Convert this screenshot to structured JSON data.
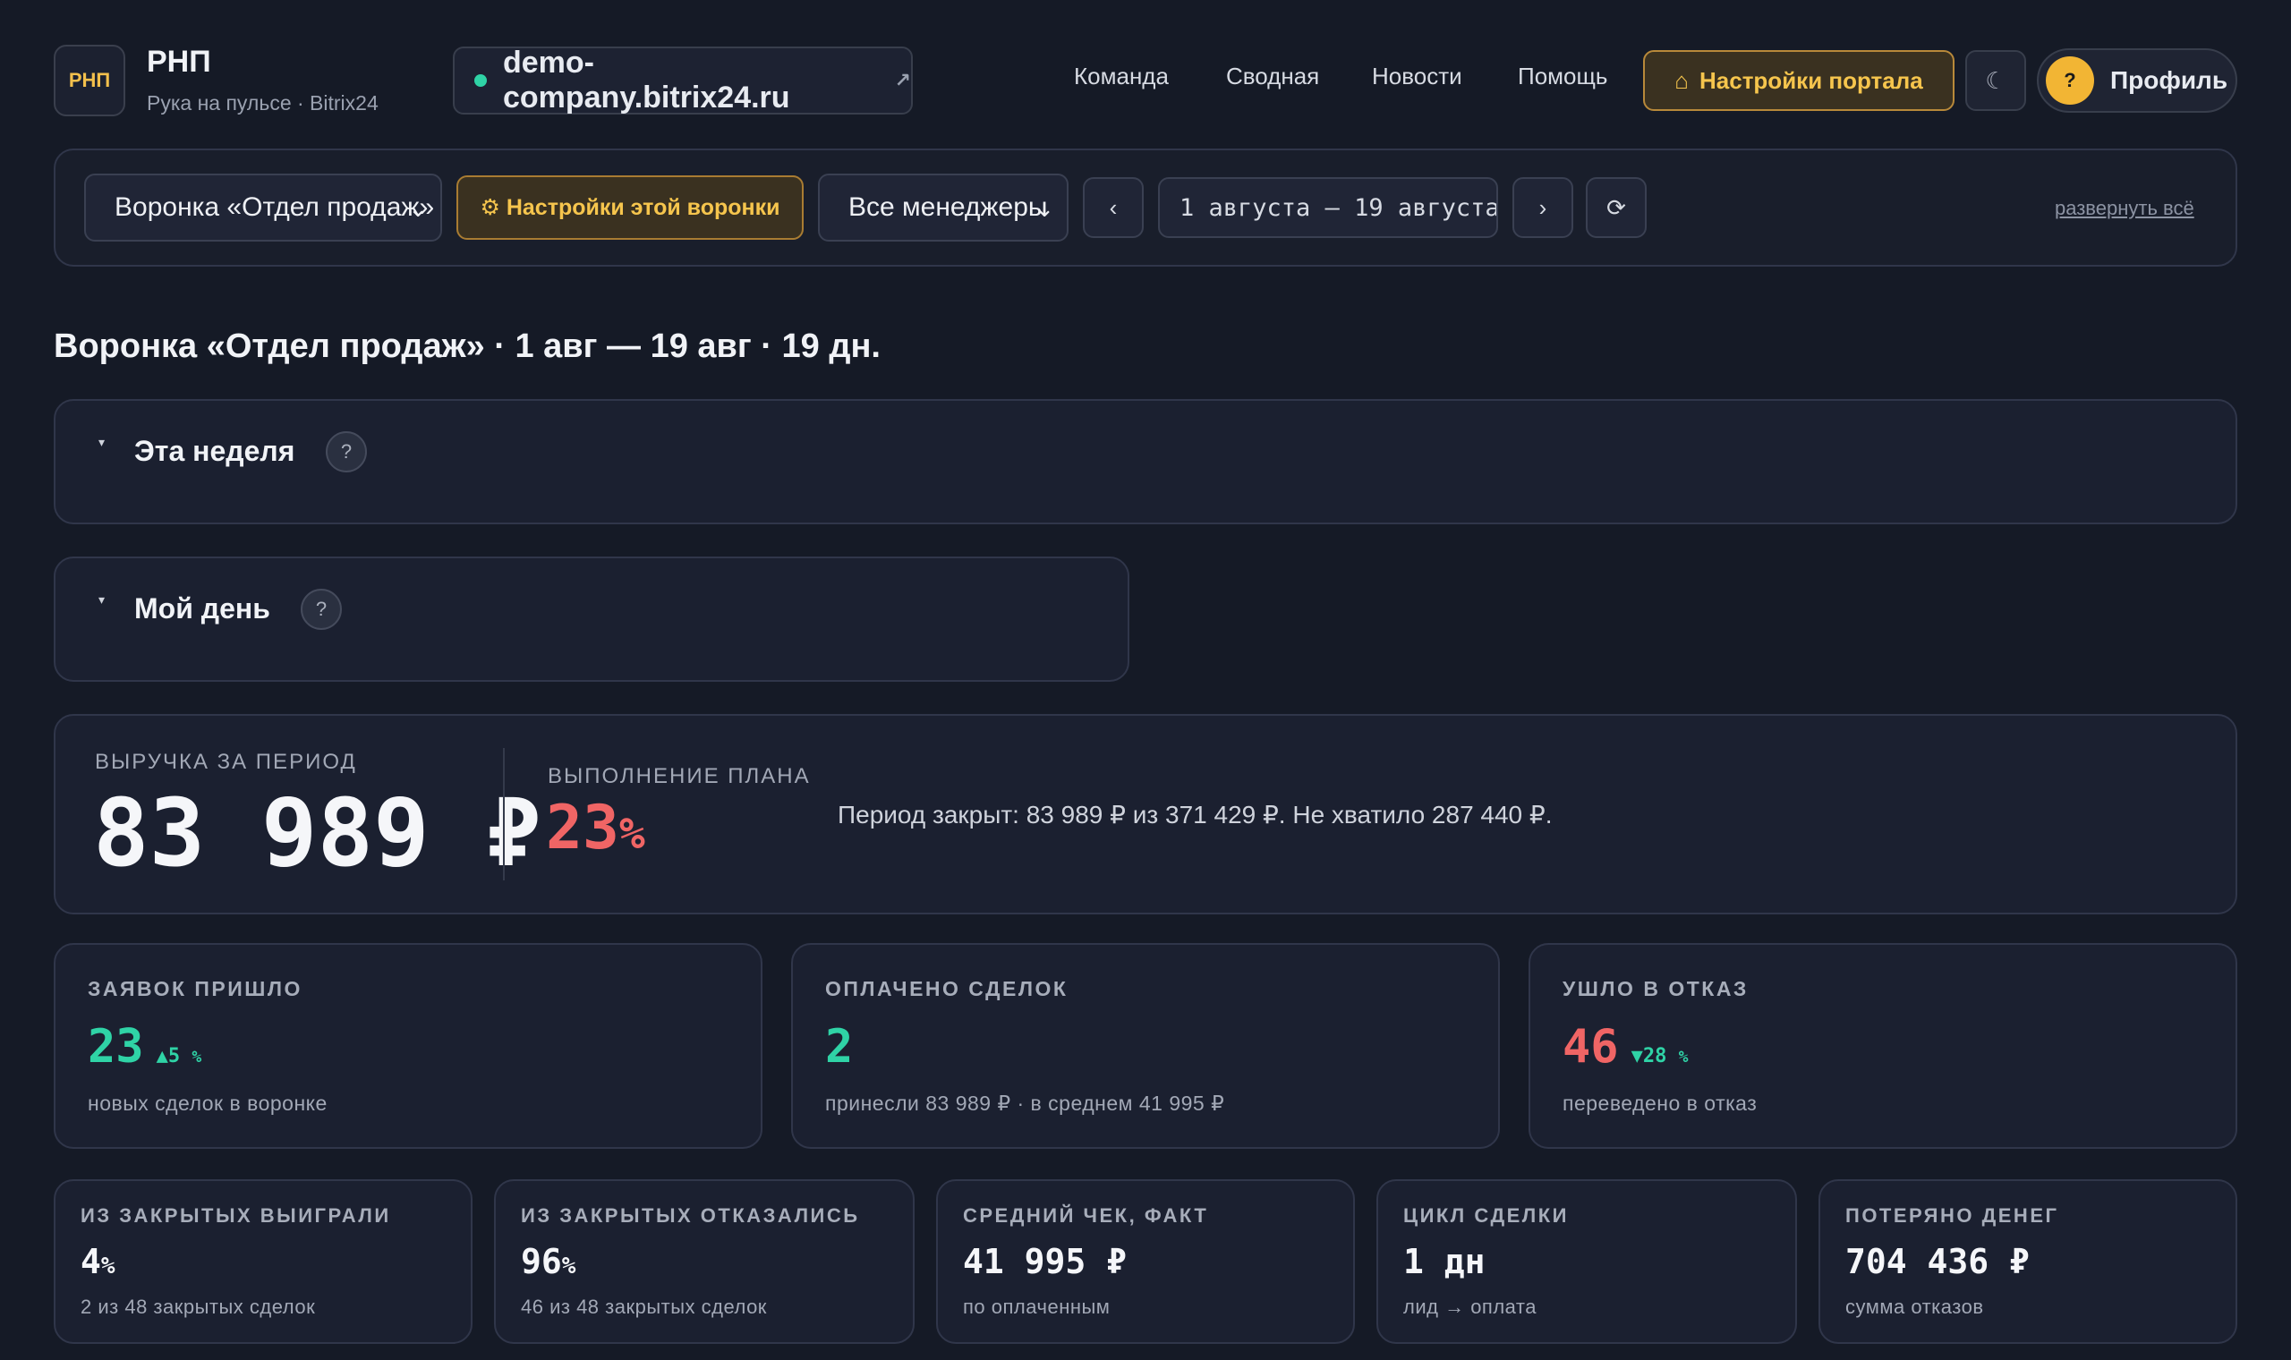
{
  "header": {
    "logo_text": "РНП",
    "title": "РНП",
    "subtitle": "Рука на пульсе · Bitrix24",
    "portal": "demo-company.bitrix24.ru",
    "portal_ext_icon": "↗",
    "nav": [
      "Команда",
      "Сводная",
      "Новости",
      "Помощь"
    ],
    "portal_settings_label": "Настройки портала",
    "portal_settings_icon": "⌂",
    "theme_icon": "☾",
    "profile_icon": "?",
    "profile_label": "Профиль"
  },
  "filters": {
    "funnel_value": "Воронка «Отдел продаж»",
    "funnel_settings_label": "⚙ Настройки этой воронки",
    "manager_value": "Все менеджеры",
    "prev_label": "‹",
    "date_range": "1 августа — 19 августа",
    "next_label": "›",
    "refresh_label": "⟳",
    "expand_all": "развернуть всё"
  },
  "page_title": "Воронка «Отдел продаж» · 1 авг — 19 авг · 19 дн.",
  "sections": {
    "week_title": "Эта неделя",
    "day_title": "Мой день",
    "help": "?",
    "caret": "▾"
  },
  "revenue": {
    "label": "ВЫРУЧКА ЗА ПЕРИОД",
    "value": "83 989 ₽",
    "plan_label": "ВЫПОЛНЕНИЕ ПЛАНА",
    "plan_value": "23",
    "plan_unit": "%",
    "plan_fraction": 0.23,
    "summary": "Период закрыт: 83 989 ₽ из 371 429 ₽. Не хватило 287 440 ₽."
  },
  "cards": [
    {
      "label": "ЗАЯВОК ПРИШЛО",
      "value": "23",
      "delta": "▲5",
      "delta_unit": "%",
      "sub": "новых сделок в воронке",
      "color": "#2fd3a6"
    },
    {
      "label": "ОПЛАЧЕНО СДЕЛОК",
      "value": "2",
      "delta": "",
      "delta_unit": "",
      "sub": "принесли 83 989 ₽ · в среднем 41 995 ₽",
      "color": "#2fd3a6"
    },
    {
      "label": "УШЛО В ОТКАЗ",
      "value": "46",
      "delta": "▼28",
      "delta_unit": "%",
      "sub": "переведено в отказ",
      "color": "#f06565"
    }
  ],
  "mini": [
    {
      "label": "ИЗ ЗАКРЫТЫХ ВЫИГРАЛИ",
      "value": "4",
      "unit": "%",
      "sub": "2 из 48 закрытых сделок"
    },
    {
      "label": "ИЗ ЗАКРЫТЫХ ОТКАЗАЛИСЬ",
      "value": "96",
      "unit": "%",
      "sub": "46 из 48 закрытых сделок"
    },
    {
      "label": "СРЕДНИЙ ЧЕК, ФАКТ",
      "value": "41 995 ₽",
      "unit": "",
      "sub": "по оплаченным"
    },
    {
      "label": "ЦИКЛ СДЕЛКИ",
      "value": "1 дн",
      "unit": "",
      "sub": "лид → оплата"
    },
    {
      "label": "ПОТЕРЯНО ДЕНЕГ",
      "value": "704 436 ₽",
      "unit": "",
      "sub": "сумма отказов"
    }
  ]
}
